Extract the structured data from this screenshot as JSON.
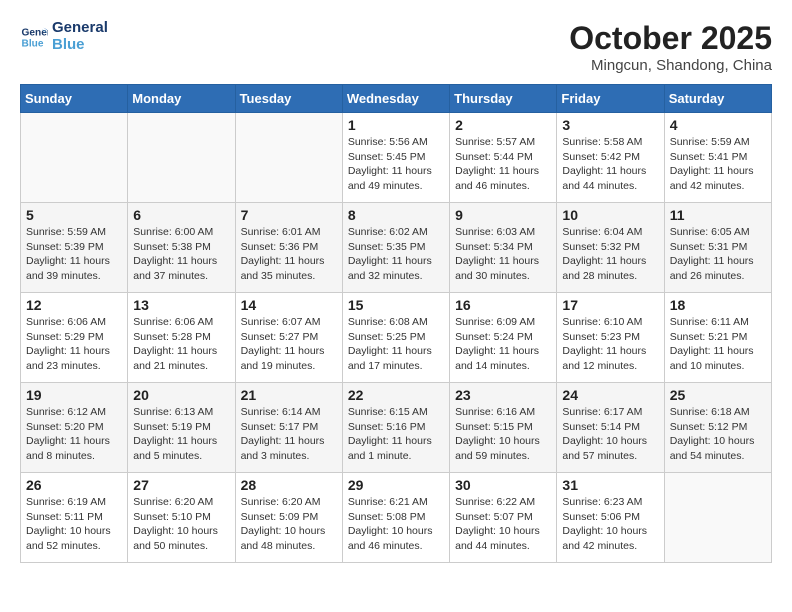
{
  "header": {
    "logo_line1": "General",
    "logo_line2": "Blue",
    "month": "October 2025",
    "location": "Mingcun, Shandong, China"
  },
  "weekdays": [
    "Sunday",
    "Monday",
    "Tuesday",
    "Wednesday",
    "Thursday",
    "Friday",
    "Saturday"
  ],
  "weeks": [
    [
      {
        "day": "",
        "info": ""
      },
      {
        "day": "",
        "info": ""
      },
      {
        "day": "",
        "info": ""
      },
      {
        "day": "1",
        "info": "Sunrise: 5:56 AM\nSunset: 5:45 PM\nDaylight: 11 hours and 49 minutes."
      },
      {
        "day": "2",
        "info": "Sunrise: 5:57 AM\nSunset: 5:44 PM\nDaylight: 11 hours and 46 minutes."
      },
      {
        "day": "3",
        "info": "Sunrise: 5:58 AM\nSunset: 5:42 PM\nDaylight: 11 hours and 44 minutes."
      },
      {
        "day": "4",
        "info": "Sunrise: 5:59 AM\nSunset: 5:41 PM\nDaylight: 11 hours and 42 minutes."
      }
    ],
    [
      {
        "day": "5",
        "info": "Sunrise: 5:59 AM\nSunset: 5:39 PM\nDaylight: 11 hours and 39 minutes."
      },
      {
        "day": "6",
        "info": "Sunrise: 6:00 AM\nSunset: 5:38 PM\nDaylight: 11 hours and 37 minutes."
      },
      {
        "day": "7",
        "info": "Sunrise: 6:01 AM\nSunset: 5:36 PM\nDaylight: 11 hours and 35 minutes."
      },
      {
        "day": "8",
        "info": "Sunrise: 6:02 AM\nSunset: 5:35 PM\nDaylight: 11 hours and 32 minutes."
      },
      {
        "day": "9",
        "info": "Sunrise: 6:03 AM\nSunset: 5:34 PM\nDaylight: 11 hours and 30 minutes."
      },
      {
        "day": "10",
        "info": "Sunrise: 6:04 AM\nSunset: 5:32 PM\nDaylight: 11 hours and 28 minutes."
      },
      {
        "day": "11",
        "info": "Sunrise: 6:05 AM\nSunset: 5:31 PM\nDaylight: 11 hours and 26 minutes."
      }
    ],
    [
      {
        "day": "12",
        "info": "Sunrise: 6:06 AM\nSunset: 5:29 PM\nDaylight: 11 hours and 23 minutes."
      },
      {
        "day": "13",
        "info": "Sunrise: 6:06 AM\nSunset: 5:28 PM\nDaylight: 11 hours and 21 minutes."
      },
      {
        "day": "14",
        "info": "Sunrise: 6:07 AM\nSunset: 5:27 PM\nDaylight: 11 hours and 19 minutes."
      },
      {
        "day": "15",
        "info": "Sunrise: 6:08 AM\nSunset: 5:25 PM\nDaylight: 11 hours and 17 minutes."
      },
      {
        "day": "16",
        "info": "Sunrise: 6:09 AM\nSunset: 5:24 PM\nDaylight: 11 hours and 14 minutes."
      },
      {
        "day": "17",
        "info": "Sunrise: 6:10 AM\nSunset: 5:23 PM\nDaylight: 11 hours and 12 minutes."
      },
      {
        "day": "18",
        "info": "Sunrise: 6:11 AM\nSunset: 5:21 PM\nDaylight: 11 hours and 10 minutes."
      }
    ],
    [
      {
        "day": "19",
        "info": "Sunrise: 6:12 AM\nSunset: 5:20 PM\nDaylight: 11 hours and 8 minutes."
      },
      {
        "day": "20",
        "info": "Sunrise: 6:13 AM\nSunset: 5:19 PM\nDaylight: 11 hours and 5 minutes."
      },
      {
        "day": "21",
        "info": "Sunrise: 6:14 AM\nSunset: 5:17 PM\nDaylight: 11 hours and 3 minutes."
      },
      {
        "day": "22",
        "info": "Sunrise: 6:15 AM\nSunset: 5:16 PM\nDaylight: 11 hours and 1 minute."
      },
      {
        "day": "23",
        "info": "Sunrise: 6:16 AM\nSunset: 5:15 PM\nDaylight: 10 hours and 59 minutes."
      },
      {
        "day": "24",
        "info": "Sunrise: 6:17 AM\nSunset: 5:14 PM\nDaylight: 10 hours and 57 minutes."
      },
      {
        "day": "25",
        "info": "Sunrise: 6:18 AM\nSunset: 5:12 PM\nDaylight: 10 hours and 54 minutes."
      }
    ],
    [
      {
        "day": "26",
        "info": "Sunrise: 6:19 AM\nSunset: 5:11 PM\nDaylight: 10 hours and 52 minutes."
      },
      {
        "day": "27",
        "info": "Sunrise: 6:20 AM\nSunset: 5:10 PM\nDaylight: 10 hours and 50 minutes."
      },
      {
        "day": "28",
        "info": "Sunrise: 6:20 AM\nSunset: 5:09 PM\nDaylight: 10 hours and 48 minutes."
      },
      {
        "day": "29",
        "info": "Sunrise: 6:21 AM\nSunset: 5:08 PM\nDaylight: 10 hours and 46 minutes."
      },
      {
        "day": "30",
        "info": "Sunrise: 6:22 AM\nSunset: 5:07 PM\nDaylight: 10 hours and 44 minutes."
      },
      {
        "day": "31",
        "info": "Sunrise: 6:23 AM\nSunset: 5:06 PM\nDaylight: 10 hours and 42 minutes."
      },
      {
        "day": "",
        "info": ""
      }
    ]
  ]
}
